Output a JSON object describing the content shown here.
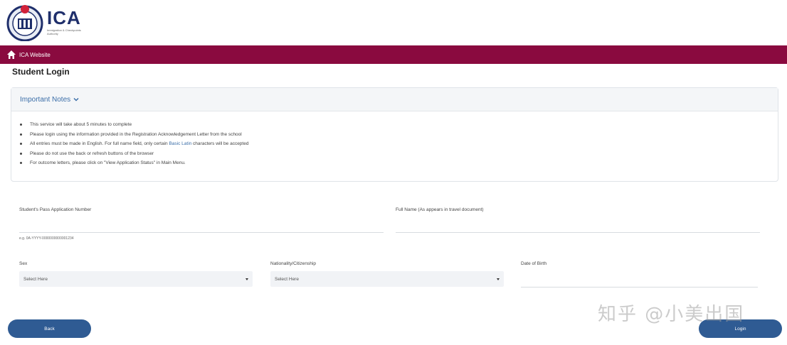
{
  "header": {
    "logo_title": "ICA",
    "logo_sub": "Immigration & Checkpoints Authority"
  },
  "navbar": {
    "home_link": "ICA Website"
  },
  "page": {
    "title": "Student Login"
  },
  "notes": {
    "title": "Important Notes",
    "items": [
      "This service will take about 5 minutes to complete",
      "Please login using the information provided in the Registration Acknowledgement Letter from the school",
      "Please do not use the back or refresh buttons of the browser",
      "For outcome letters, please click on \"View Application Status\" in Main Menu."
    ],
    "item3_before": "All entries must be made in English. For full name field, only certain ",
    "item3_link": "Basic Latin",
    "item3_after": " characters will be accepted"
  },
  "form": {
    "pass_label": "Student's Pass Application Number",
    "pass_hint": "e.g. 0A-YYYY-0000000000001234",
    "name_label": "Full Name (As appears in travel document)",
    "sex_label": "Sex",
    "sex_value": "Select Here",
    "nationality_label": "Nationality/Citizenship",
    "nationality_value": "Select Here",
    "dob_label": "Date of Birth"
  },
  "buttons": {
    "back": "Back",
    "login": "Login"
  },
  "watermark": "知乎 @小美出国",
  "colors": {
    "navbar": "#8a0a3f",
    "button": "#2f5b93",
    "link": "#3b6ea8"
  }
}
